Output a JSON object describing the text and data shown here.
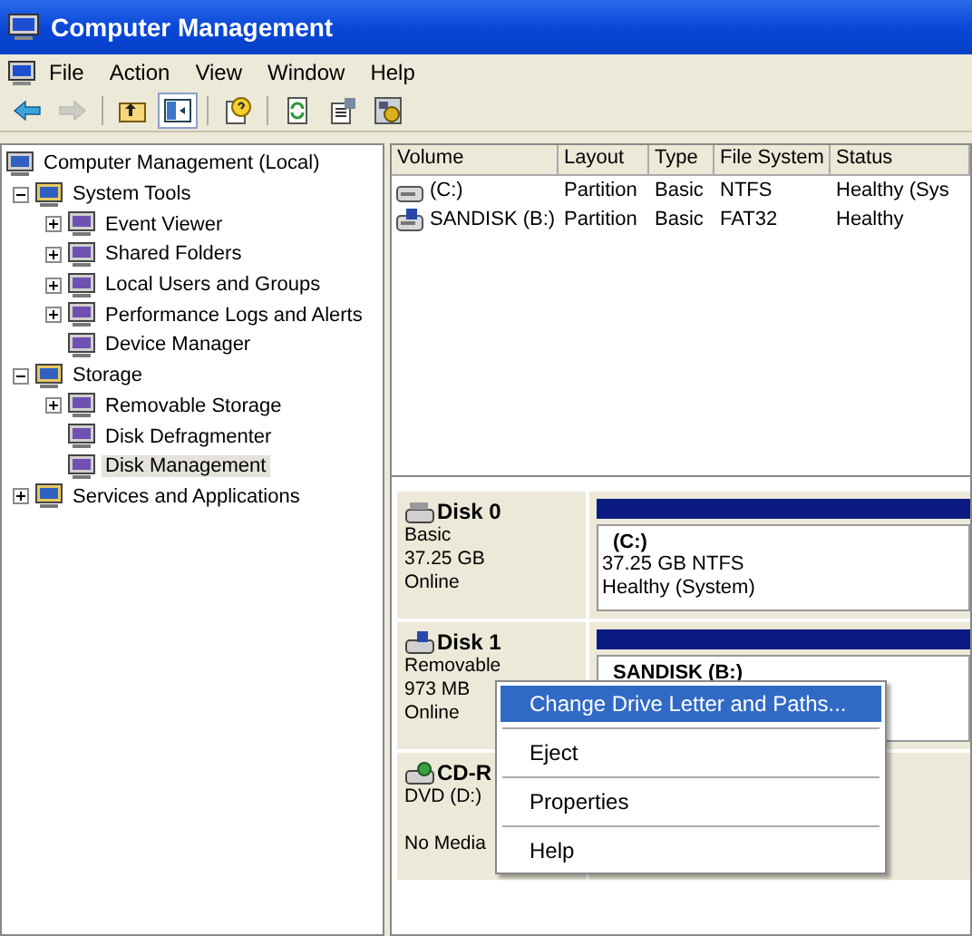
{
  "window": {
    "title": "Computer Management"
  },
  "menu_bar": [
    "File",
    "Action",
    "View",
    "Window",
    "Help"
  ],
  "toolbar": [
    {
      "kind": "back",
      "disabled": false,
      "on": false
    },
    {
      "kind": "forward",
      "disabled": true,
      "on": false
    },
    {
      "kind": "up",
      "disabled": false,
      "on": false
    },
    {
      "kind": "tree",
      "disabled": false,
      "on": true
    },
    {
      "kind": "help",
      "disabled": false,
      "on": false
    },
    {
      "kind": "refresh",
      "disabled": false,
      "on": false
    },
    {
      "kind": "properties",
      "disabled": false,
      "on": false
    },
    {
      "kind": "settings",
      "disabled": false,
      "on": false
    }
  ],
  "tree": [
    {
      "label": "Computer Management (Local)",
      "selected": false,
      "children": [
        {
          "label": "System Tools",
          "selected": false,
          "expanded": true,
          "children": [
            {
              "label": "Event Viewer",
              "selected": false,
              "expanded": false
            },
            {
              "label": "Shared Folders",
              "selected": false,
              "expanded": false
            },
            {
              "label": "Local Users and Groups",
              "selected": false,
              "expanded": false
            },
            {
              "label": "Performance Logs and Alerts",
              "selected": false,
              "expanded": false
            },
            {
              "label": "Device Manager",
              "selected": false
            }
          ]
        },
        {
          "label": "Storage",
          "selected": false,
          "expanded": true,
          "children": [
            {
              "label": "Removable Storage",
              "selected": false,
              "expanded": false
            },
            {
              "label": "Disk Defragmenter",
              "selected": false
            },
            {
              "label": "Disk Management",
              "selected": true
            }
          ]
        },
        {
          "label": "Services and Applications",
          "selected": false,
          "expanded": false
        }
      ]
    }
  ],
  "volume_table": {
    "columns": [
      "Volume",
      "Layout",
      "Type",
      "File System",
      "Status"
    ],
    "rows": [
      [
        "(C:)",
        "Partition",
        "Basic",
        "NTFS",
        "Healthy (Sys"
      ],
      [
        "SANDISK (B:)",
        "Partition",
        "Basic",
        "FAT32",
        "Healthy"
      ]
    ]
  },
  "disks": [
    {
      "name": "Disk 0",
      "lines": [
        "Basic",
        "37.25 GB",
        "Online"
      ],
      "partition": {
        "name": "(C:)",
        "lines": [
          "37.25 GB NTFS",
          "Healthy (System)"
        ]
      }
    },
    {
      "name": "Disk 1",
      "lines": [
        "Removable",
        "973 MB",
        "Online"
      ],
      "partition": {
        "name": "SANDISK (B:)"
      }
    },
    {
      "name": "CD-R",
      "lines": [
        "DVD (D:)"
      ],
      "footer": "No Media"
    }
  ],
  "context_menu": [
    {
      "label": "Change Drive Letter and Paths...",
      "selected": true
    },
    {
      "label": "Eject",
      "selected": false
    },
    {
      "label": "Properties",
      "selected": false
    },
    {
      "label": "Help",
      "selected": false
    }
  ]
}
